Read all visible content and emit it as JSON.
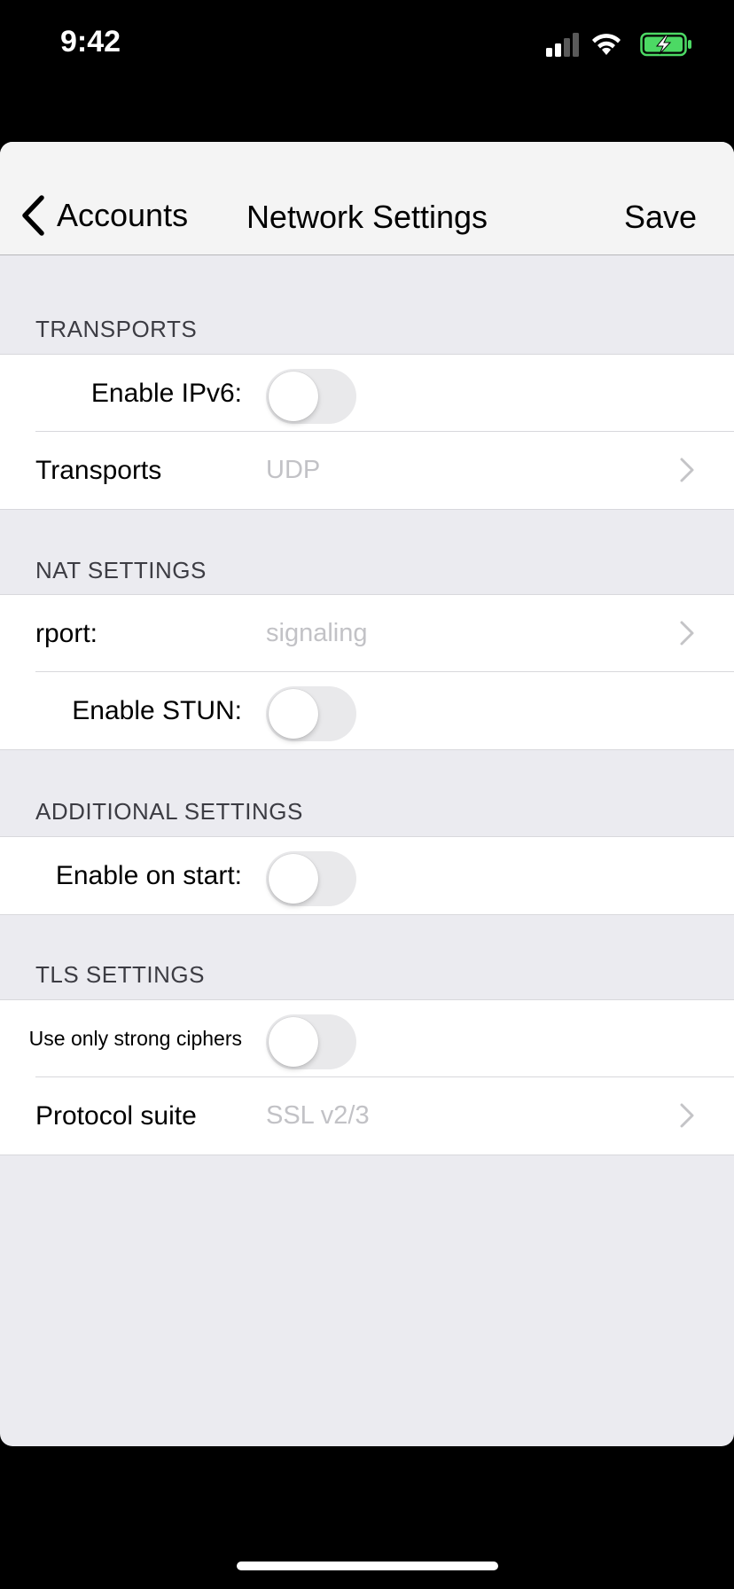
{
  "status_bar": {
    "time": "9:42",
    "icons": [
      "signal-icon",
      "wifi-icon",
      "battery-charging-icon"
    ],
    "battery_color": "#4CD964"
  },
  "nav": {
    "back_label": "Accounts",
    "title": "Network Settings",
    "save_label": "Save"
  },
  "sections": {
    "transports": {
      "header": "TRANSPORTS",
      "enable_ipv6": {
        "label": "Enable IPv6:",
        "on": false
      },
      "transports": {
        "label": "Transports",
        "value": "UDP"
      }
    },
    "nat": {
      "header": "NAT SETTINGS",
      "rport": {
        "label": "rport:",
        "value": "signaling"
      },
      "enable_stun": {
        "label": "Enable STUN:",
        "on": false
      }
    },
    "additional": {
      "header": "ADDITIONAL SETTINGS",
      "enable_on_start": {
        "label": "Enable on start:",
        "on": false
      }
    },
    "tls": {
      "header": "TLS SETTINGS",
      "strong_ciphers": {
        "label": "Use only strong ciphers",
        "on": false
      },
      "protocol_suite": {
        "label": "Protocol suite",
        "value": "SSL v2/3"
      }
    }
  }
}
